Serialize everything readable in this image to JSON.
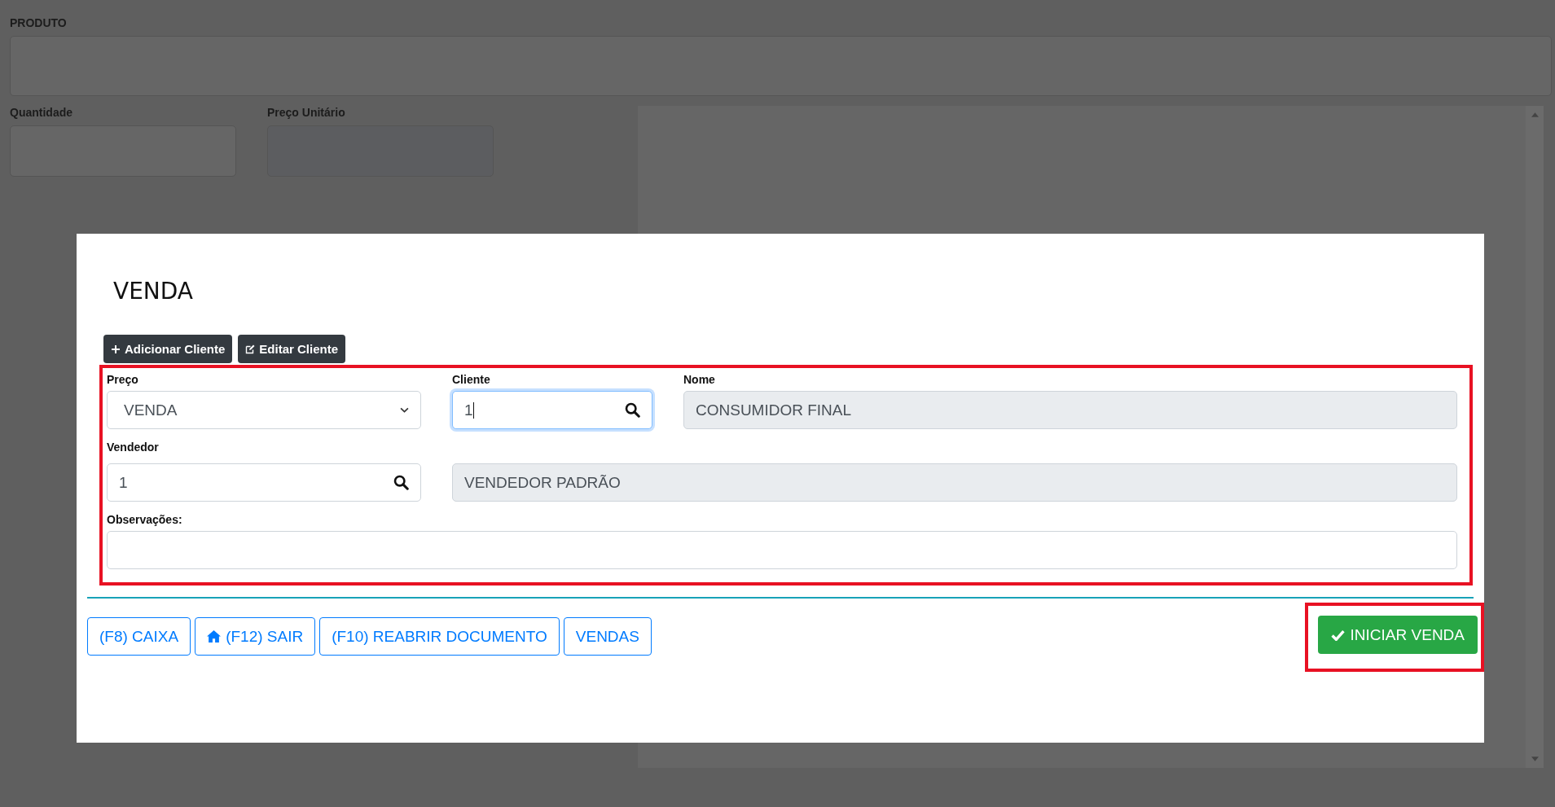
{
  "background": {
    "product_label": "PRODUTO",
    "fields": [
      {
        "label": "Quantidade"
      },
      {
        "label": "Preço Unitário"
      }
    ]
  },
  "modal": {
    "title": "VENDA",
    "actions": [
      {
        "label": "Adicionar Cliente"
      },
      {
        "label": "Editar Cliente"
      }
    ],
    "rows": [
      [
        {
          "kind": "select",
          "label": "Preço",
          "value": "VENDA"
        },
        {
          "kind": "search",
          "label": "Cliente",
          "value": "1",
          "focused": true
        },
        {
          "kind": "readonly",
          "label": "Nome",
          "value": "CONSUMIDOR FINAL"
        }
      ],
      [
        {
          "kind": "search",
          "label": "Vendedor",
          "value": "1",
          "focused": false
        },
        {
          "kind": "readonly",
          "value": "VENDEDOR PADRÃO"
        }
      ],
      [
        {
          "kind": "text",
          "label": "Observações:"
        }
      ]
    ],
    "footer_buttons": [
      {
        "label": "(F8) CAIXA"
      },
      {
        "label": "(F12) SAIR"
      },
      {
        "label": "(F10) REABRIR DOCUMENTO"
      },
      {
        "label": "VENDAS"
      }
    ],
    "primary_button": {
      "label": "INICIAR VENDA"
    }
  }
}
